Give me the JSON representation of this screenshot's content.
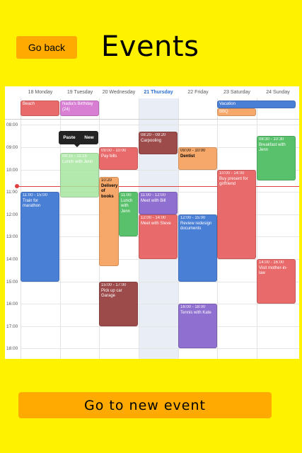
{
  "header": {
    "back_label": "Go back",
    "title": "Events"
  },
  "calendar": {
    "days": [
      "18 Monday",
      "19 Tuesday",
      "20 Wednesday",
      "21 Thursday",
      "22 Friday",
      "23 Saturday",
      "24 Sunday"
    ],
    "hours": [
      "08:00",
      "09:00",
      "10:00",
      "11:00",
      "12:00",
      "13:00",
      "14:00",
      "15:00",
      "16:00",
      "17:00",
      "18:00"
    ],
    "allday": {
      "beach": "Beach",
      "birthday": "Nadia's Birthday (24)",
      "vacation": "Vacation",
      "bbq": "BBQ"
    },
    "popup": {
      "paste": "Paste",
      "new": "New"
    },
    "events": {
      "lunch_tue": {
        "time": "09:15 - 11:15",
        "name": "Lunch with Jenn"
      },
      "pay_bills": {
        "time": "09:00 - 10:00",
        "name": "Pay bills"
      },
      "carpooling": {
        "time": "08:20 - 09:20",
        "name": "Carpooling"
      },
      "dentist": {
        "time": "09:00 - 10:00",
        "name": "Dentist"
      },
      "breakfast": {
        "time": "08:30 - 10:30",
        "name": "Breakfast with Jenn"
      },
      "buy_present": {
        "time": "10:00 - 14:00",
        "name": "Buy present for girlfriend"
      },
      "train": {
        "time": "11:00 - 15:00",
        "name": "Train for marathon"
      },
      "delivery": {
        "time": "10:20",
        "name": "Delivery of books"
      },
      "lunch_wed": {
        "time": "11:00",
        "name": "Lunch with Jenn"
      },
      "meet_bill": {
        "time": "11:00 - 12:00",
        "name": "Meet with Bill"
      },
      "meet_steve": {
        "time": "12:00 - 14:00",
        "name": "Meet with Steve"
      },
      "review": {
        "time": "12:00 - 15:00",
        "name": "Review redesign documents"
      },
      "pickup_car": {
        "time": "15:00 - 17:00",
        "name": "Pick up car Garage"
      },
      "tennis": {
        "time": "16:00 - 18:00",
        "name": "Tennis with Kate"
      },
      "visit_mother": {
        "time": "14:00 - 16:00",
        "name": "Visit mother-in-law"
      }
    }
  },
  "footer": {
    "new_event_label": "Go to new event"
  },
  "colors": {
    "background": "#fff200",
    "button": "#ffaa00"
  }
}
